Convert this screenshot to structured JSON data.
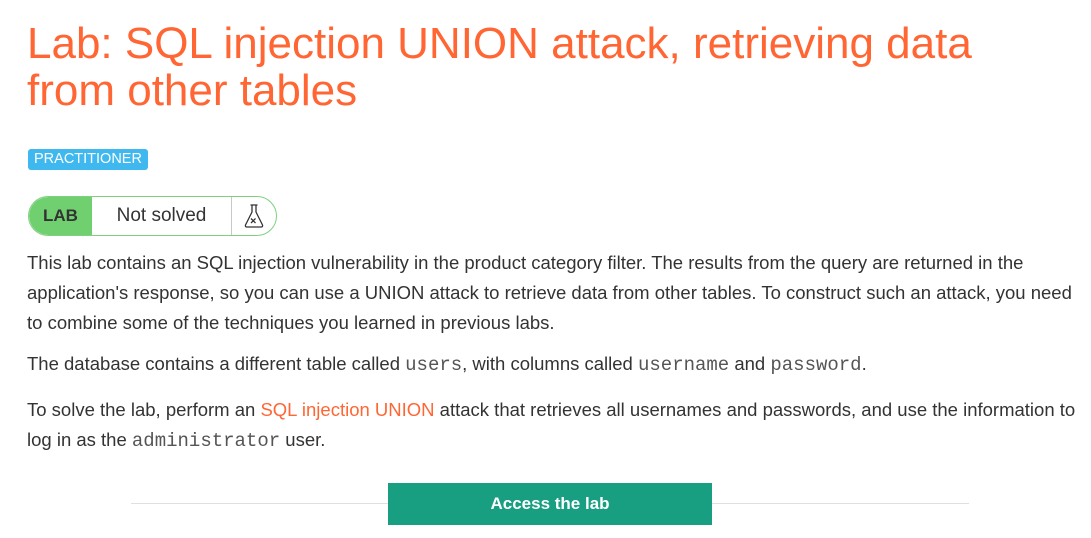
{
  "title": "Lab: SQL injection UNION attack, retrieving data from other tables",
  "level_badge": "PRACTITIONER",
  "status": {
    "lab_label": "LAB",
    "state": "Not solved",
    "icon": "flask-icon"
  },
  "description": {
    "p1": "This lab contains an SQL injection vulnerability in the product category filter. The results from the query are returned in the application's response, so you can use a UNION attack to retrieve data from other tables. To construct such an attack, you need to combine some of the techniques you learned in previous labs.",
    "p2": {
      "t1": "The database contains a different table called ",
      "code1": "users",
      "t2": ", with columns called ",
      "code2": "username",
      "t3": " and ",
      "code3": "password",
      "t4": "."
    },
    "p3": {
      "t1": "To solve the lab, perform an ",
      "link": "SQL injection UNION",
      "t2": " attack that retrieves all usernames and passwords, and use the information to log in as the ",
      "code1": "administrator",
      "t3": " user."
    }
  },
  "access_button": "Access the lab",
  "colors": {
    "title": "#ff6633",
    "badge": "#3fb8f0",
    "lab_pill": "#70d070",
    "button": "#189e80"
  }
}
